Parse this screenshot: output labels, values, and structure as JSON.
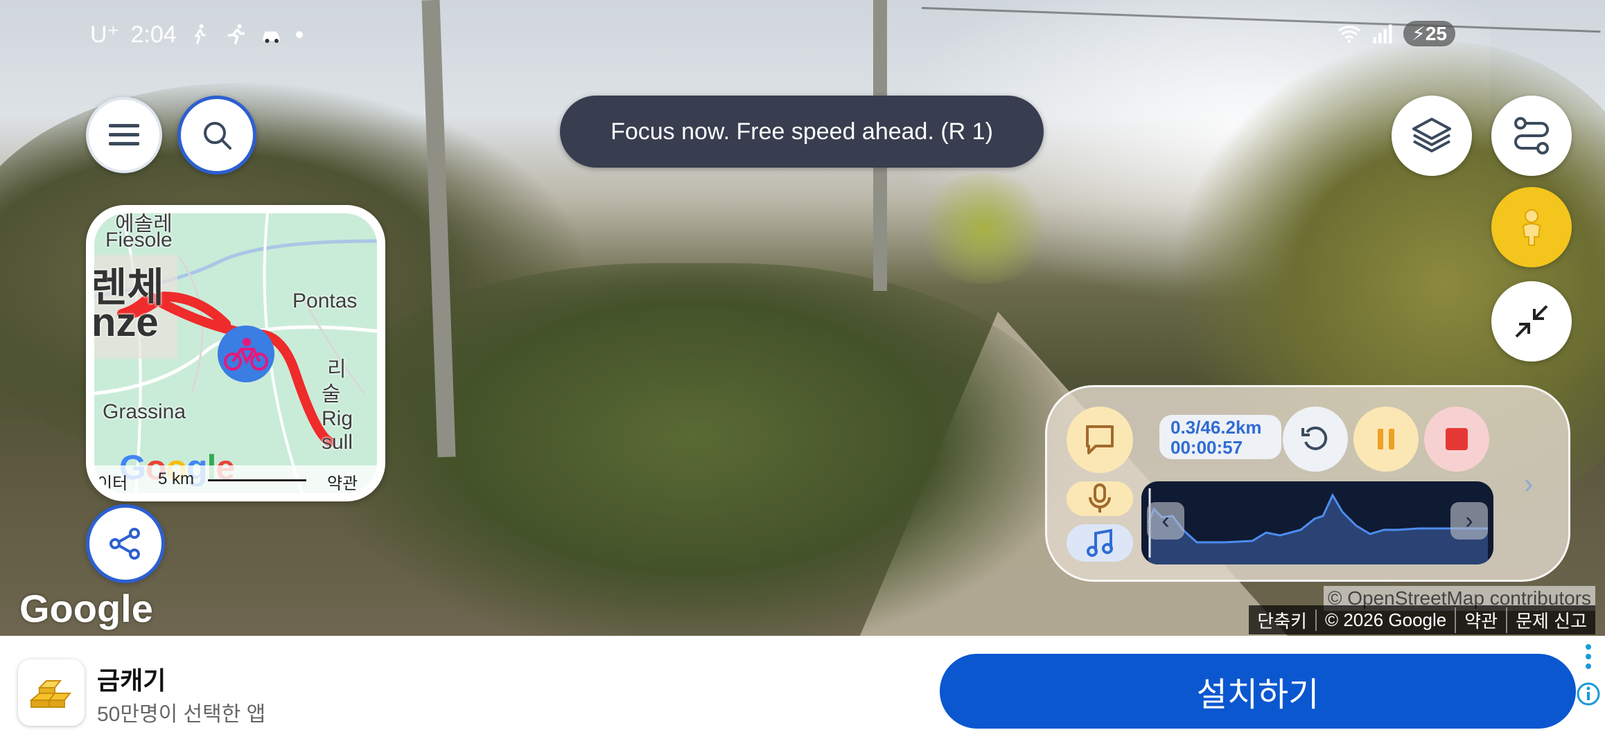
{
  "status_bar": {
    "carrier": "U⁺",
    "time": "2:04",
    "battery": "25",
    "left_icons": [
      "walk-icon",
      "run-icon",
      "car-icon"
    ],
    "right_icons": [
      "wifi-icon",
      "signal-icon",
      "battery-charging-icon"
    ]
  },
  "toast": {
    "message": "Focus now. Free speed ahead. (R 1)"
  },
  "minimap": {
    "labels": [
      "피에솔레",
      "Fiesole",
      "렌체",
      "nze",
      "Pontas",
      "Grassina",
      "리\n술\n",
      "Rig\nsull",
      "리",
      "술",
      "Rig",
      "sull"
    ],
    "place_top_korean": "에솔레",
    "place_fiesole": "Fiesole",
    "place_big_korean": "렌체",
    "place_big_latin": "nze",
    "place_pontas": "Pontas",
    "place_grassina": "Grassina",
    "place_korean_2a": "리",
    "place_korean_2b": "술",
    "place_rig": "Rig",
    "place_sull": "sull",
    "google_logo": "Google",
    "scale_left": "이터",
    "scale_distance": "5 km",
    "terms": "약관",
    "route_color": "#ef2b2b",
    "rider_color": "#3a7de3"
  },
  "panel": {
    "distance": "0.3/46.2km",
    "elapsed": "00:00:57",
    "nav_prev": "‹",
    "nav_next": "›",
    "outer_next": "›"
  },
  "attribution": {
    "watermark": "Google",
    "osm": "© OpenStreetMap contributors",
    "items": [
      "단축키",
      "© 2026 Google",
      "약관",
      "문제 신고"
    ]
  },
  "ad": {
    "title": "금캐기",
    "subtitle": "50만명이 선택한 앱",
    "install_label": "설치하기",
    "accent": "#0b57d0"
  },
  "colors": {
    "brand_blue": "#2d5fd0",
    "pegman_yellow": "#f3c51d",
    "toast_bg": "#383d4f",
    "stop_red": "#e53935",
    "pause_orange": "#f0a024"
  }
}
